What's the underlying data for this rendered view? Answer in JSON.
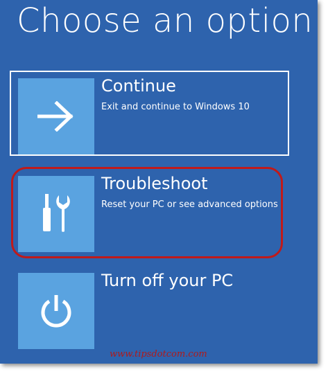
{
  "screen": {
    "title": "Choose an option"
  },
  "options": [
    {
      "title": "Continue",
      "description": "Exit and continue to Windows 10",
      "icon": "arrow-right-icon"
    },
    {
      "title": "Troubleshoot",
      "description": "Reset your PC or see advanced options",
      "icon": "tools-icon"
    },
    {
      "title": "Turn off your PC",
      "description": "",
      "icon": "power-icon"
    }
  ],
  "watermark": "www.tipsdotcom.com",
  "colors": {
    "background": "#2e63ad",
    "tile": "#5aa3e0",
    "text": "#ffffff",
    "annotation": "#c01a1a"
  }
}
